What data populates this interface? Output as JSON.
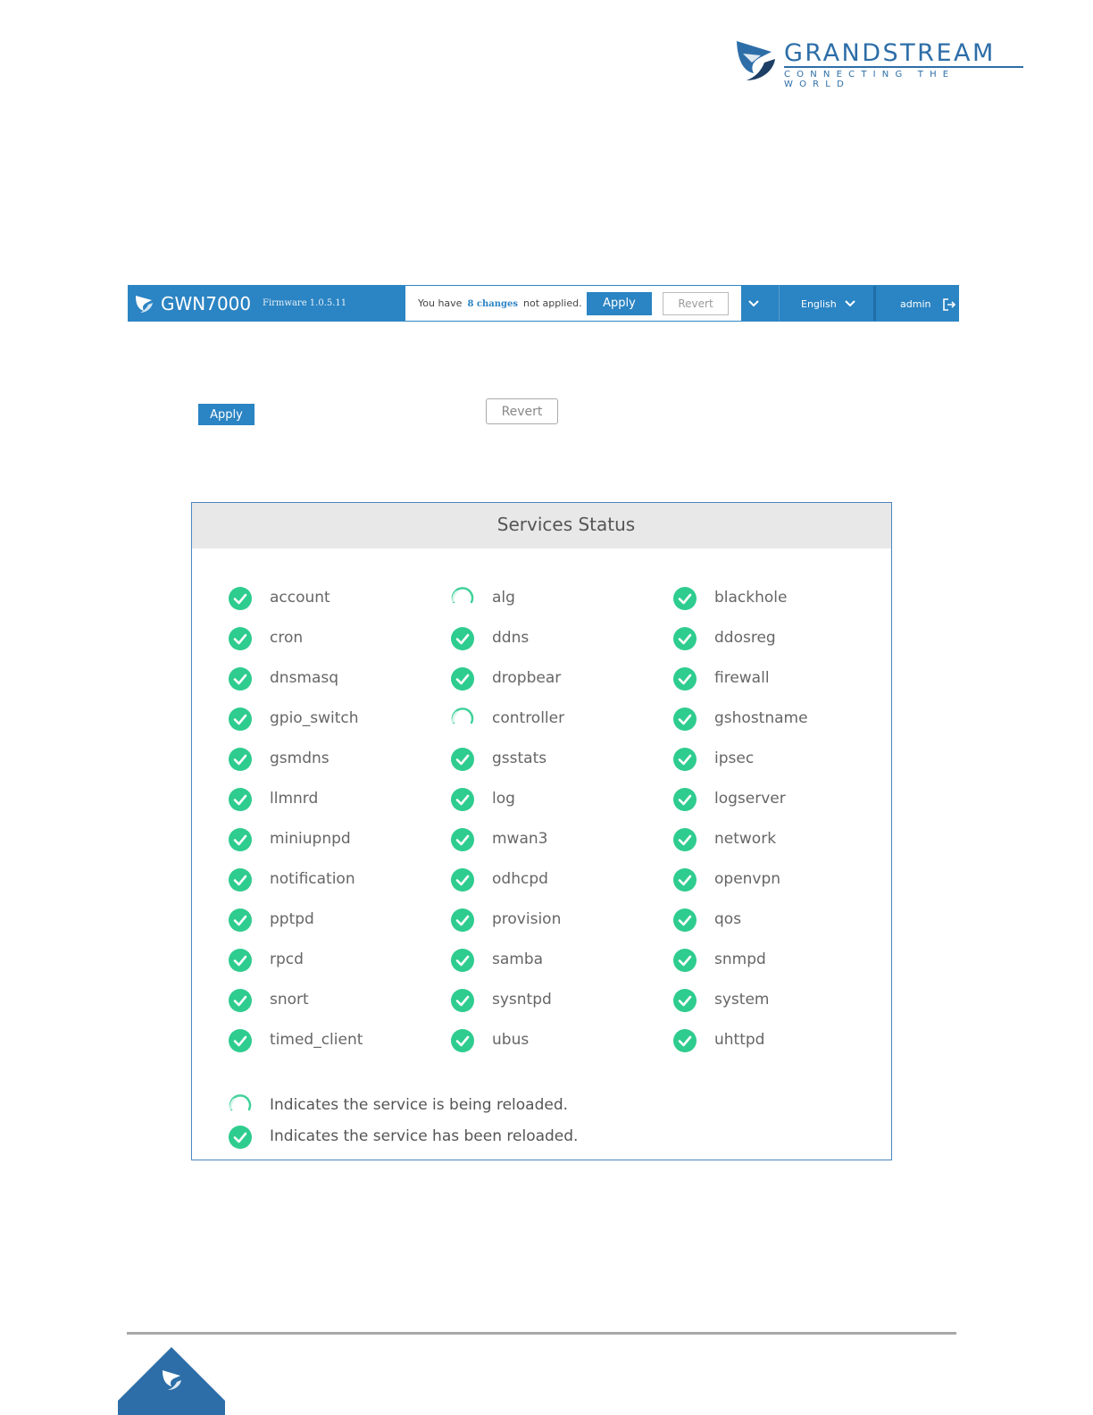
{
  "brand": {
    "name": "GRANDSTREAM",
    "tagline": "CONNECTING THE WORLD",
    "color": "#2d6ea8"
  },
  "topbar": {
    "model": "GWN7000",
    "firmware": "Firmware 1.0.5.11",
    "msg_prefix": "You have",
    "changes": "8 changes",
    "msg_suffix": "not applied.",
    "apply_label": "Apply",
    "revert_label": "Revert",
    "language": "English",
    "user": "admin",
    "accent": "#2b84c3"
  },
  "buttons": {
    "apply_label": "Apply",
    "revert_label": "Revert"
  },
  "services": {
    "title": "Services Status",
    "items": [
      {
        "name": "account",
        "status": "reloaded"
      },
      {
        "name": "alg",
        "status": "reloading"
      },
      {
        "name": "blackhole",
        "status": "reloaded"
      },
      {
        "name": "cron",
        "status": "reloaded"
      },
      {
        "name": "ddns",
        "status": "reloaded"
      },
      {
        "name": "ddosreg",
        "status": "reloaded"
      },
      {
        "name": "dnsmasq",
        "status": "reloaded"
      },
      {
        "name": "dropbear",
        "status": "reloaded"
      },
      {
        "name": "firewall",
        "status": "reloaded"
      },
      {
        "name": "gpio_switch",
        "status": "reloaded"
      },
      {
        "name": "controller",
        "status": "reloading"
      },
      {
        "name": "gshostname",
        "status": "reloaded"
      },
      {
        "name": "gsmdns",
        "status": "reloaded"
      },
      {
        "name": "gsstats",
        "status": "reloaded"
      },
      {
        "name": "ipsec",
        "status": "reloaded"
      },
      {
        "name": "llmnrd",
        "status": "reloaded"
      },
      {
        "name": "log",
        "status": "reloaded"
      },
      {
        "name": "logserver",
        "status": "reloaded"
      },
      {
        "name": "miniupnpd",
        "status": "reloaded"
      },
      {
        "name": "mwan3",
        "status": "reloaded"
      },
      {
        "name": "network",
        "status": "reloaded"
      },
      {
        "name": "notification",
        "status": "reloaded"
      },
      {
        "name": "odhcpd",
        "status": "reloaded"
      },
      {
        "name": "openvpn",
        "status": "reloaded"
      },
      {
        "name": "pptpd",
        "status": "reloaded"
      },
      {
        "name": "provision",
        "status": "reloaded"
      },
      {
        "name": "qos",
        "status": "reloaded"
      },
      {
        "name": "rpcd",
        "status": "reloaded"
      },
      {
        "name": "samba",
        "status": "reloaded"
      },
      {
        "name": "snmpd",
        "status": "reloaded"
      },
      {
        "name": "snort",
        "status": "reloaded"
      },
      {
        "name": "sysntpd",
        "status": "reloaded"
      },
      {
        "name": "system",
        "status": "reloaded"
      },
      {
        "name": "timed_client",
        "status": "reloaded"
      },
      {
        "name": "ubus",
        "status": "reloaded"
      },
      {
        "name": "uhttpd",
        "status": "reloaded"
      }
    ],
    "legend": [
      {
        "status": "reloading",
        "text": "Indicates the service is being reloaded."
      },
      {
        "status": "reloaded",
        "text": "Indicates the service has been reloaded."
      }
    ],
    "check_color": "#2ecc8f"
  }
}
